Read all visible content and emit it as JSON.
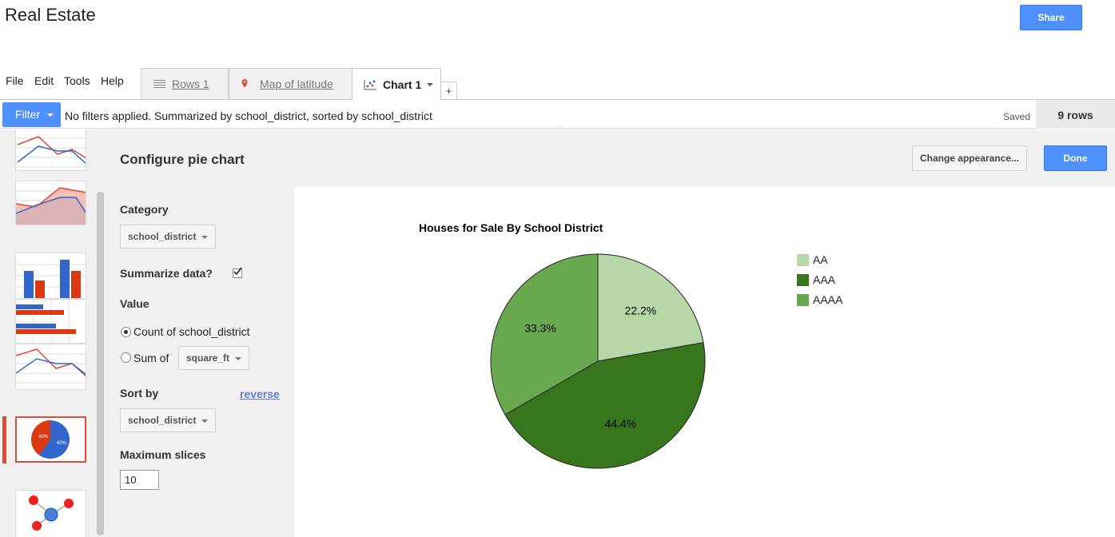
{
  "app": {
    "title": "Real Estate",
    "share_label": "Share"
  },
  "menu": {
    "items": [
      "File",
      "Edit",
      "Tools",
      "Help"
    ]
  },
  "tabs": [
    {
      "label": "Rows 1",
      "icon": "rows-icon"
    },
    {
      "label": "Map of latitude",
      "icon": "map-pin-icon"
    },
    {
      "label": "Chart 1",
      "icon": "scatter-chart-icon"
    }
  ],
  "add_tab_label": "+",
  "filter": {
    "button_label": "Filter",
    "summary": "No filters applied. Summarized by school_district, sorted by school_district",
    "saved": "Saved",
    "rows": "9 rows"
  },
  "config": {
    "title": "Configure pie chart",
    "change_label": "Change appearance...",
    "done_label": "Done",
    "category_label": "Category",
    "category_value": "school_district",
    "summarize_label": "Summarize data?",
    "summarize_checked": true,
    "value_label": "Value",
    "count_label": "Count of school_district",
    "sum_label": "Sum of",
    "sum_field": "square_ft",
    "sort_label": "Sort by",
    "reverse_label": "reverse",
    "sort_value": "school_district",
    "max_slices_label": "Maximum slices",
    "max_slices_value": "10"
  },
  "gallery": {
    "thumbs": [
      "line-chart-thumb",
      "area-chart-thumb",
      "column-chart-thumb",
      "bar-chart-thumb",
      "line-chart-thumb",
      "pie-chart-thumb",
      "network-chart-thumb"
    ],
    "selected": "pie-chart-thumb",
    "pie_thumb_labels": [
      "40%",
      "60%"
    ]
  },
  "chart_data": {
    "type": "pie",
    "title": "Houses for Sale By School District",
    "categories": [
      "AA",
      "AAA",
      "AAAA"
    ],
    "values": [
      22.2,
      44.4,
      33.3
    ],
    "labels": [
      "22.2%",
      "44.4%",
      "33.3%"
    ],
    "colors": [
      "#b6d7a8",
      "#38761d",
      "#6aa84f"
    ],
    "legend": "right"
  }
}
